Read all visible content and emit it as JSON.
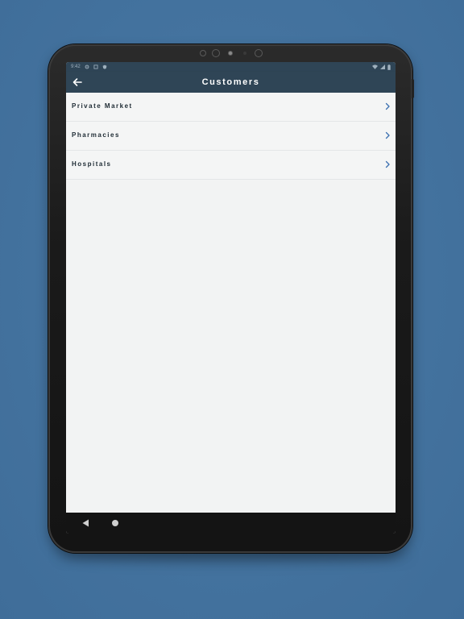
{
  "app_bar": {
    "title": "Customers",
    "back_icon": "arrow-left-icon"
  },
  "status_bar": {
    "time": "9:42"
  },
  "customer_list": [
    {
      "label": "Private Market"
    },
    {
      "label": "Pharmacies"
    },
    {
      "label": "Hospitals"
    }
  ],
  "colors": {
    "app_bar": "#2f4556",
    "background": "#43729e",
    "chevron": "#3b6fb0"
  }
}
